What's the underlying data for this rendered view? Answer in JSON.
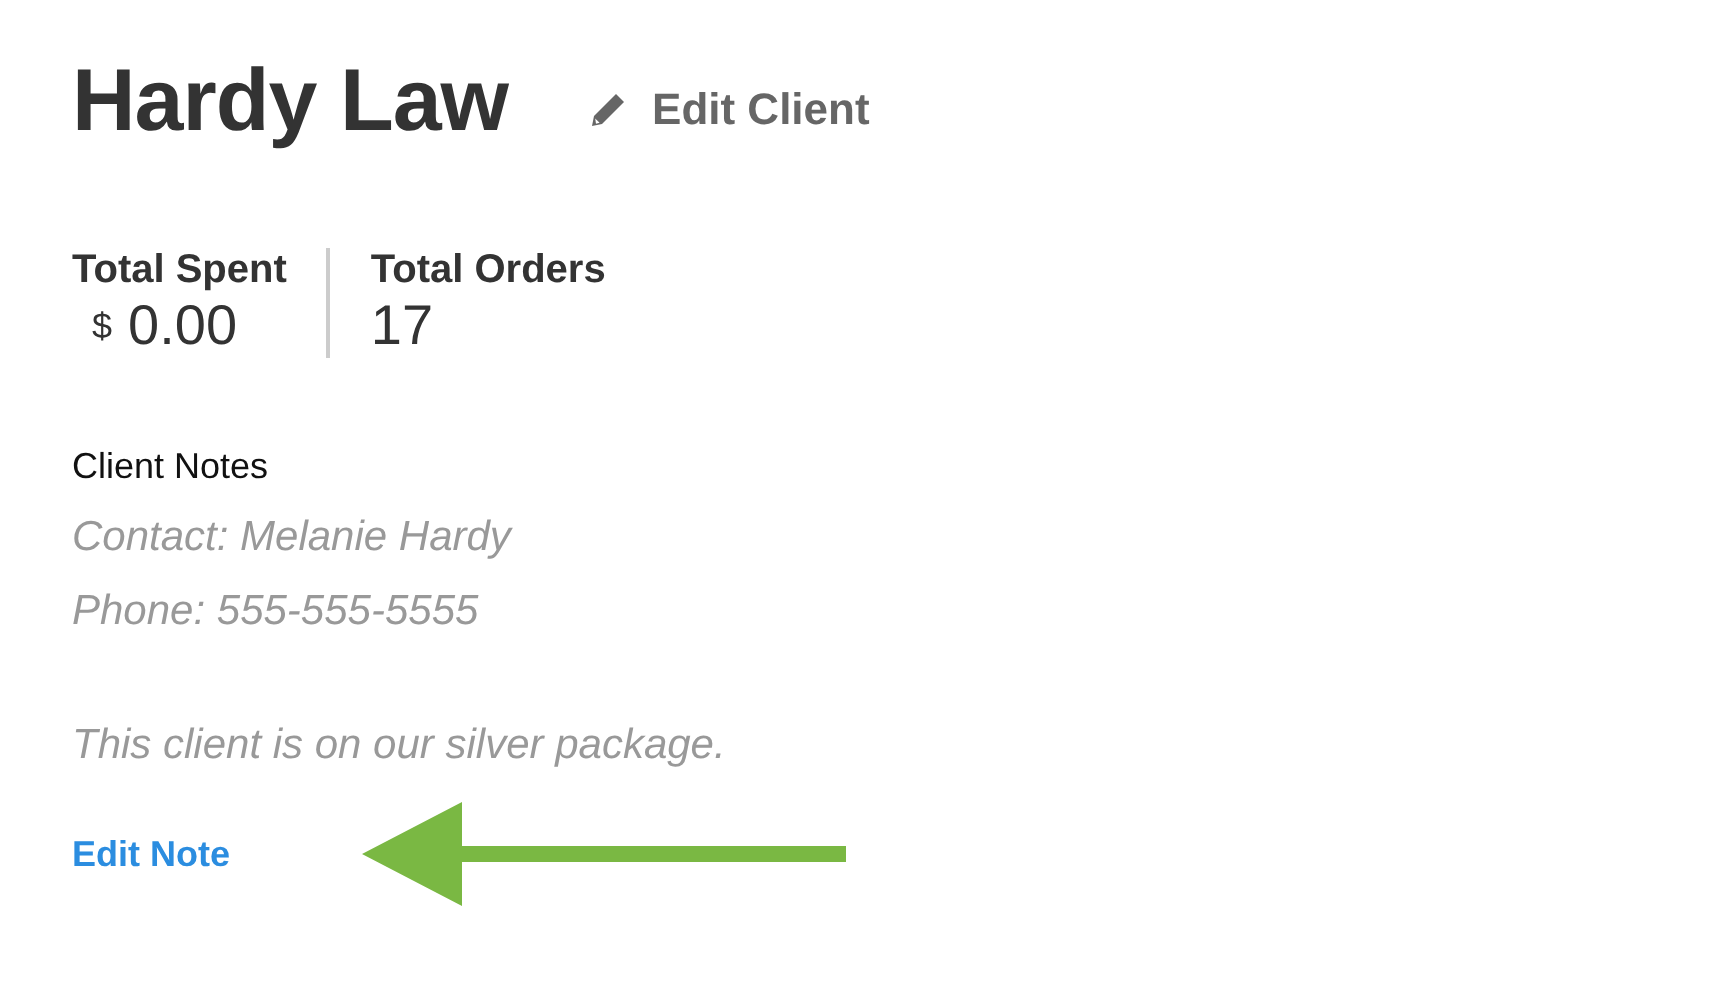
{
  "client": {
    "name": "Hardy Law",
    "edit_label": "Edit Client"
  },
  "stats": [
    {
      "label": "Total Spent",
      "currency": "$",
      "value": "0.00"
    },
    {
      "label": "Total Orders",
      "value": "17"
    }
  ],
  "notes": {
    "heading": "Client Notes",
    "paragraphs": [
      {
        "lines": [
          "Contact: Melanie Hardy",
          "Phone: 555-555-5555"
        ]
      },
      {
        "lines": [
          "This client is on our silver package."
        ]
      }
    ],
    "edit_label": "Edit Note"
  }
}
